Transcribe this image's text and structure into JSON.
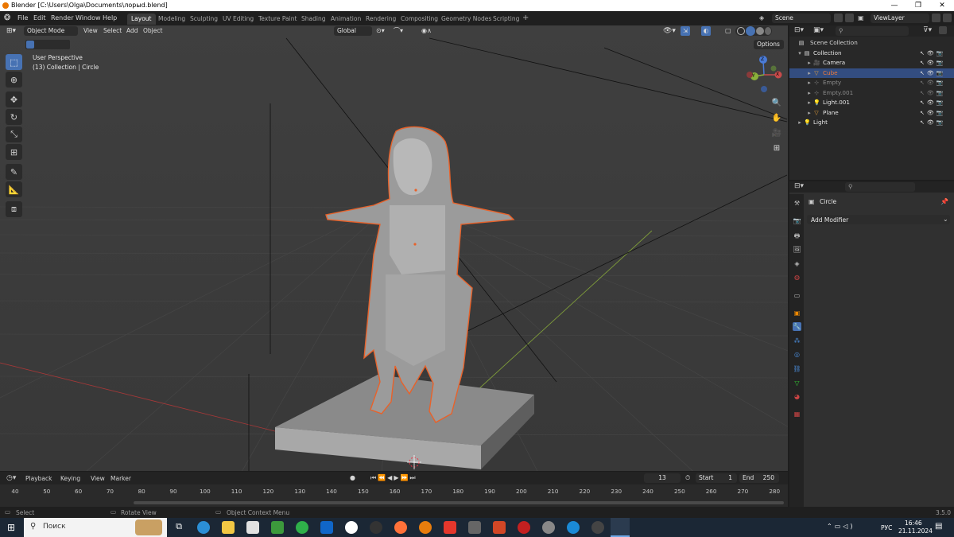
{
  "window": {
    "title": "Blender [C:\\Users\\Olga\\Documents\\лорыd.blend]",
    "minimize": "—",
    "maximize": "❐",
    "close": "✕"
  },
  "menu": {
    "items": [
      "File",
      "Edit",
      "Render",
      "Window",
      "Help"
    ]
  },
  "workspaces": {
    "tabs": [
      "Layout",
      "Modeling",
      "Sculpting",
      "UV Editing",
      "Texture Paint",
      "Shading",
      "Animation",
      "Rendering",
      "Compositing",
      "Geometry Nodes",
      "Scripting"
    ],
    "active": "Layout",
    "add": "+"
  },
  "scene": {
    "name": "Scene",
    "view_layer": "ViewLayer"
  },
  "viewport_header": {
    "mode": "Object Mode",
    "menus": [
      "View",
      "Select",
      "Add",
      "Object"
    ],
    "orientation": "Global",
    "options": "Options"
  },
  "viewport": {
    "perspective": "User Perspective",
    "collection_info": "(13) Collection | Circle",
    "gizmo": {
      "x": "X",
      "y": "Y",
      "z": "Z"
    }
  },
  "outliner": {
    "scene_collection": "Scene Collection",
    "rows": [
      {
        "label": "Collection",
        "icon": "collection-icon",
        "color": "#e6e6e6",
        "indent": 1
      },
      {
        "label": "Camera",
        "icon": "camera-icon",
        "color": "#e6e6e6",
        "indent": 2
      },
      {
        "label": "Cube",
        "icon": "mesh-icon",
        "color": "#ee7a3a",
        "indent": 2,
        "selected": true
      },
      {
        "label": "Empty",
        "icon": "empty-icon",
        "color": "#8a8a8a",
        "indent": 2
      },
      {
        "label": "Empty.001",
        "icon": "empty-icon",
        "color": "#8a8a8a",
        "indent": 2
      },
      {
        "label": "Light.001",
        "icon": "light-icon",
        "color": "#e6e6e6",
        "indent": 2
      },
      {
        "label": "Plane",
        "icon": "mesh-icon",
        "color": "#e6e6e6",
        "indent": 2
      },
      {
        "label": "Light",
        "icon": "light-icon",
        "color": "#e6e6e6",
        "indent": 1
      }
    ]
  },
  "properties": {
    "object_name": "Circle",
    "add_modifier": "Add Modifier"
  },
  "timeline": {
    "menus": [
      "Playback",
      "Keying",
      "View",
      "Marker"
    ],
    "current_frame": "13",
    "start_label": "Start",
    "start": "1",
    "end_label": "End",
    "end": "250",
    "ticks": [
      "40",
      "50",
      "60",
      "70",
      "80",
      "90",
      "100",
      "110",
      "120",
      "130",
      "140",
      "150",
      "160",
      "170",
      "180",
      "190",
      "200",
      "210",
      "220",
      "230",
      "240",
      "250",
      "260",
      "270",
      "280"
    ]
  },
  "statusbar": {
    "select": "Select",
    "rotate": "Rotate View",
    "context": "Object Context Menu",
    "version": "3.5.0"
  },
  "taskbar": {
    "search_placeholder": "Поиск",
    "lang": "РУС",
    "time": "16:46",
    "date": "21.11.2024"
  },
  "colors": {
    "accent": "#4772b3",
    "selection_outline": "#e8622a",
    "viewport_bg": "#3d3d3d"
  }
}
